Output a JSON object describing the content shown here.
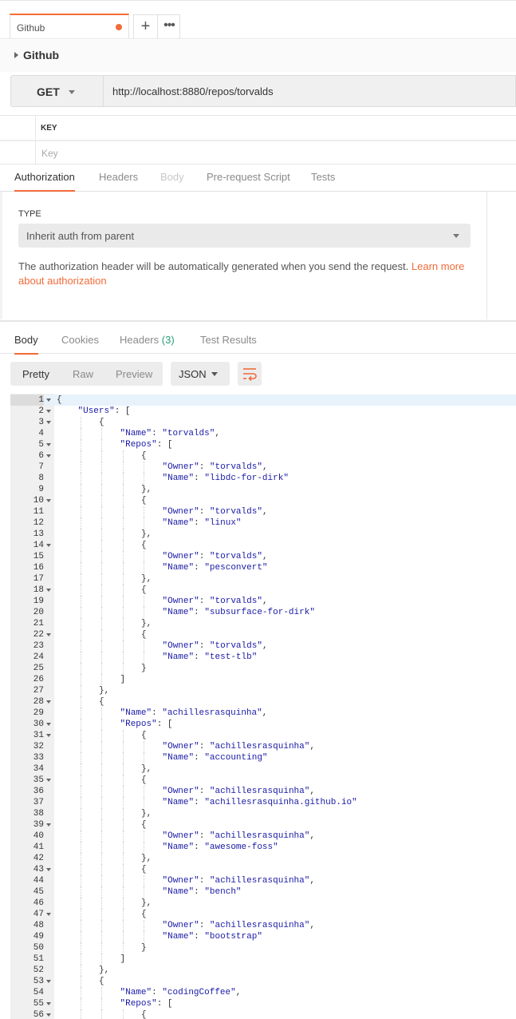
{
  "tabs": {
    "active_label": "Github",
    "add_label": "+",
    "more_label": "•••"
  },
  "breadcrumb": {
    "title": "Github"
  },
  "request": {
    "method": "GET",
    "url": "http://localhost:8880/repos/torvalds"
  },
  "params": {
    "key_header": "KEY",
    "key_placeholder": "Key"
  },
  "request_tabs": [
    "Authorization",
    "Headers",
    "Body",
    "Pre-request Script",
    "Tests"
  ],
  "auth": {
    "type_label": "TYPE",
    "type_value": "Inherit auth from parent",
    "description": "The authorization header will be automatically generated when you send the request.",
    "learn_more_1": "Learn more",
    "learn_more_2": "about authorization"
  },
  "response_tabs": {
    "body": "Body",
    "cookies": "Cookies",
    "headers": "Headers",
    "headers_count": "(3)",
    "test_results": "Test Results"
  },
  "response_toolbar": {
    "pretty": "Pretty",
    "raw": "Raw",
    "preview": "Preview",
    "format": "JSON"
  },
  "colors": {
    "accent": "#f26b3a",
    "json_key": "#1a1aa6",
    "count_green": "#26a07a"
  },
  "code_lines": [
    {
      "n": "1",
      "fold": true,
      "indent": 0,
      "text": "{"
    },
    {
      "n": "2",
      "fold": true,
      "indent": 1,
      "key": "\"Users\"",
      "rest": ": ["
    },
    {
      "n": "3",
      "fold": true,
      "indent": 2,
      "text": "{"
    },
    {
      "n": "4",
      "fold": false,
      "indent": 3,
      "key": "\"Name\"",
      "val": "\"torvalds\"",
      "rest": ","
    },
    {
      "n": "5",
      "fold": true,
      "indent": 3,
      "key": "\"Repos\"",
      "rest": ": ["
    },
    {
      "n": "6",
      "fold": true,
      "indent": 4,
      "text": "{"
    },
    {
      "n": "7",
      "fold": false,
      "indent": 5,
      "key": "\"Owner\"",
      "val": "\"torvalds\"",
      "rest": ","
    },
    {
      "n": "8",
      "fold": false,
      "indent": 5,
      "key": "\"Name\"",
      "val": "\"libdc-for-dirk\"",
      "rest": ""
    },
    {
      "n": "9",
      "fold": false,
      "indent": 4,
      "text": "},"
    },
    {
      "n": "10",
      "fold": true,
      "indent": 4,
      "text": "{"
    },
    {
      "n": "11",
      "fold": false,
      "indent": 5,
      "key": "\"Owner\"",
      "val": "\"torvalds\"",
      "rest": ","
    },
    {
      "n": "12",
      "fold": false,
      "indent": 5,
      "key": "\"Name\"",
      "val": "\"linux\"",
      "rest": ""
    },
    {
      "n": "13",
      "fold": false,
      "indent": 4,
      "text": "},"
    },
    {
      "n": "14",
      "fold": true,
      "indent": 4,
      "text": "{"
    },
    {
      "n": "15",
      "fold": false,
      "indent": 5,
      "key": "\"Owner\"",
      "val": "\"torvalds\"",
      "rest": ","
    },
    {
      "n": "16",
      "fold": false,
      "indent": 5,
      "key": "\"Name\"",
      "val": "\"pesconvert\"",
      "rest": ""
    },
    {
      "n": "17",
      "fold": false,
      "indent": 4,
      "text": "},"
    },
    {
      "n": "18",
      "fold": true,
      "indent": 4,
      "text": "{"
    },
    {
      "n": "19",
      "fold": false,
      "indent": 5,
      "key": "\"Owner\"",
      "val": "\"torvalds\"",
      "rest": ","
    },
    {
      "n": "20",
      "fold": false,
      "indent": 5,
      "key": "\"Name\"",
      "val": "\"subsurface-for-dirk\"",
      "rest": ""
    },
    {
      "n": "21",
      "fold": false,
      "indent": 4,
      "text": "},"
    },
    {
      "n": "22",
      "fold": true,
      "indent": 4,
      "text": "{"
    },
    {
      "n": "23",
      "fold": false,
      "indent": 5,
      "key": "\"Owner\"",
      "val": "\"torvalds\"",
      "rest": ","
    },
    {
      "n": "24",
      "fold": false,
      "indent": 5,
      "key": "\"Name\"",
      "val": "\"test-tlb\"",
      "rest": ""
    },
    {
      "n": "25",
      "fold": false,
      "indent": 4,
      "text": "}"
    },
    {
      "n": "26",
      "fold": false,
      "indent": 3,
      "text": "]"
    },
    {
      "n": "27",
      "fold": false,
      "indent": 2,
      "text": "},"
    },
    {
      "n": "28",
      "fold": true,
      "indent": 2,
      "text": "{"
    },
    {
      "n": "29",
      "fold": false,
      "indent": 3,
      "key": "\"Name\"",
      "val": "\"achillesrasquinha\"",
      "rest": ","
    },
    {
      "n": "30",
      "fold": true,
      "indent": 3,
      "key": "\"Repos\"",
      "rest": ": ["
    },
    {
      "n": "31",
      "fold": true,
      "indent": 4,
      "text": "{"
    },
    {
      "n": "32",
      "fold": false,
      "indent": 5,
      "key": "\"Owner\"",
      "val": "\"achillesrasquinha\"",
      "rest": ","
    },
    {
      "n": "33",
      "fold": false,
      "indent": 5,
      "key": "\"Name\"",
      "val": "\"accounting\"",
      "rest": ""
    },
    {
      "n": "34",
      "fold": false,
      "indent": 4,
      "text": "},"
    },
    {
      "n": "35",
      "fold": true,
      "indent": 4,
      "text": "{"
    },
    {
      "n": "36",
      "fold": false,
      "indent": 5,
      "key": "\"Owner\"",
      "val": "\"achillesrasquinha\"",
      "rest": ","
    },
    {
      "n": "37",
      "fold": false,
      "indent": 5,
      "key": "\"Name\"",
      "val": "\"achillesrasquinha.github.io\"",
      "rest": ""
    },
    {
      "n": "38",
      "fold": false,
      "indent": 4,
      "text": "},"
    },
    {
      "n": "39",
      "fold": true,
      "indent": 4,
      "text": "{"
    },
    {
      "n": "40",
      "fold": false,
      "indent": 5,
      "key": "\"Owner\"",
      "val": "\"achillesrasquinha\"",
      "rest": ","
    },
    {
      "n": "41",
      "fold": false,
      "indent": 5,
      "key": "\"Name\"",
      "val": "\"awesome-foss\"",
      "rest": ""
    },
    {
      "n": "42",
      "fold": false,
      "indent": 4,
      "text": "},"
    },
    {
      "n": "43",
      "fold": true,
      "indent": 4,
      "text": "{"
    },
    {
      "n": "44",
      "fold": false,
      "indent": 5,
      "key": "\"Owner\"",
      "val": "\"achillesrasquinha\"",
      "rest": ","
    },
    {
      "n": "45",
      "fold": false,
      "indent": 5,
      "key": "\"Name\"",
      "val": "\"bench\"",
      "rest": ""
    },
    {
      "n": "46",
      "fold": false,
      "indent": 4,
      "text": "},"
    },
    {
      "n": "47",
      "fold": true,
      "indent": 4,
      "text": "{"
    },
    {
      "n": "48",
      "fold": false,
      "indent": 5,
      "key": "\"Owner\"",
      "val": "\"achillesrasquinha\"",
      "rest": ","
    },
    {
      "n": "49",
      "fold": false,
      "indent": 5,
      "key": "\"Name\"",
      "val": "\"bootstrap\"",
      "rest": ""
    },
    {
      "n": "50",
      "fold": false,
      "indent": 4,
      "text": "}"
    },
    {
      "n": "51",
      "fold": false,
      "indent": 3,
      "text": "]"
    },
    {
      "n": "52",
      "fold": false,
      "indent": 2,
      "text": "},"
    },
    {
      "n": "53",
      "fold": true,
      "indent": 2,
      "text": "{"
    },
    {
      "n": "54",
      "fold": false,
      "indent": 3,
      "key": "\"Name\"",
      "val": "\"codingCoffee\"",
      "rest": ","
    },
    {
      "n": "55",
      "fold": true,
      "indent": 3,
      "key": "\"Repos\"",
      "rest": ": ["
    },
    {
      "n": "56",
      "fold": true,
      "indent": 4,
      "text": "{"
    }
  ]
}
